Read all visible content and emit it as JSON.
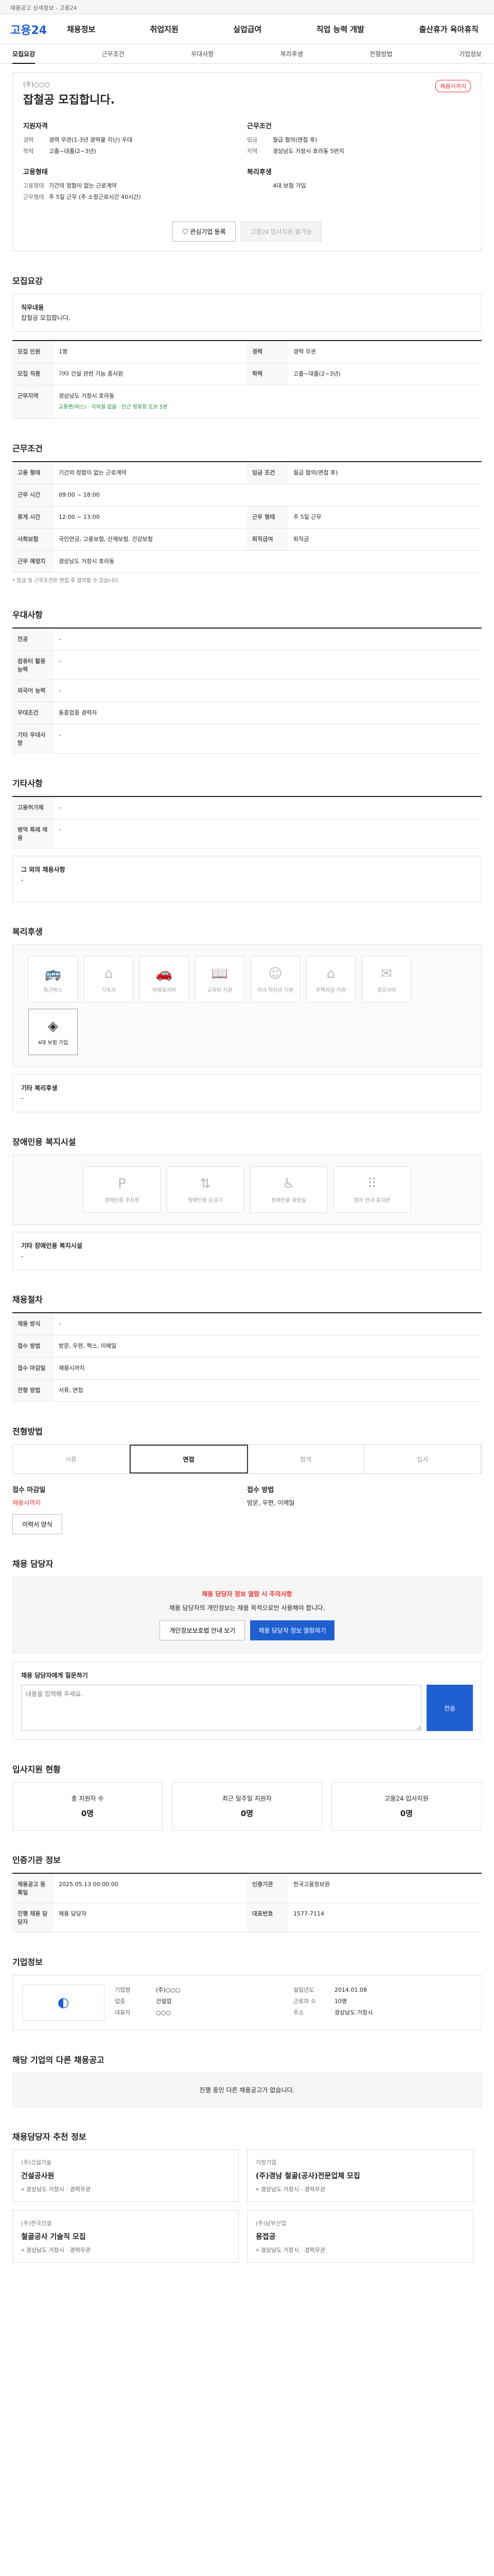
{
  "topbar": "채용공고 상세정보 - 고용24",
  "logo": "고용24",
  "gnb": [
    "채용정보",
    "취업지원",
    "실업급여",
    "직업 능력 개발",
    "출산휴가 육아휴직"
  ],
  "tabs": [
    "모집요강",
    "근무조건",
    "우대사항",
    "복리후생",
    "전형방법",
    "기업정보"
  ],
  "head": {
    "corp": "(주)○○○",
    "title": "잡철공 모집합니다.",
    "badge": "채용시까지"
  },
  "summary": {
    "left_title": "지원자격",
    "left": [
      [
        "경력",
        "경력 무관(1-3년 경력을 지닌) 우대"
      ],
      [
        "학력",
        "고졸~대졸(2~3년)"
      ]
    ],
    "right_title": "근무조건",
    "right": [
      [
        "임금",
        "월급 협의(면접 후)"
      ],
      [
        "지역",
        "경상남도 거창시 호라동 5번지"
      ]
    ],
    "left2_title": "고용형태",
    "left2": [
      [
        "고용형태",
        "기간의 정함이 없는 근로계약"
      ],
      [
        "근무형태",
        "주 5일 근무 (주 소정근로시간 40시간)"
      ]
    ],
    "right2_title": "복리후생",
    "right2": [
      [
        "",
        "4대 보험 가입"
      ]
    ]
  },
  "buttons": {
    "apply": "관심기업 등록",
    "online": "고용24 입사지원 불가능"
  },
  "s1": {
    "title": "모집요강",
    "job_label": "직무내용",
    "job": "잡철공 모집합니다.",
    "rows": [
      [
        "모집 인원",
        "1명"
      ],
      [
        "경력",
        "경력 무관"
      ],
      [
        "모집 직종",
        "기타 건설 관련 기능 종사원"
      ],
      [
        "학력",
        "고졸~대졸(2~3년)"
      ],
      [
        "근무지역",
        "경상남도 거창시 호라동"
      ]
    ],
    "badges": [
      "교통편(버스)",
      "지하철 없음",
      "인근 정류장 도보 5분"
    ]
  },
  "s2": {
    "title": "근무조건",
    "rows": [
      [
        "고용 형태",
        "기간의 정함이 없는 근로계약"
      ],
      [
        "임금 조건",
        "월급 협의(면접 후)"
      ],
      [
        "근무 시간",
        "09:00 ~ 18:00"
      ],
      [
        "휴게 시간",
        "12:00 ~ 13:00"
      ],
      [
        "근무 형태",
        "주 5일 근무"
      ],
      [
        "사회보험",
        "국민연금, 고용보험, 산재보험, 건강보험"
      ],
      [
        "근무 예정지",
        "경상남도 거창시 호라동"
      ],
      [
        "퇴직급여",
        "퇴직금"
      ]
    ],
    "note": "* 임금 및 근무조건은 면접 후 협의할 수 있습니다."
  },
  "s3": {
    "title": "우대사항",
    "rows": [
      [
        "전공",
        "-"
      ],
      [
        "컴퓨터 활용 능력",
        "-"
      ],
      [
        "외국어 능력",
        "-"
      ],
      [
        "우대조건",
        "동종업종 경력자"
      ],
      [
        "기타 우대사항",
        "-"
      ]
    ]
  },
  "s4": {
    "title": "기타사항",
    "rows": [
      [
        "고용허가제",
        "-"
      ],
      [
        "병역 특례 채용",
        "-"
      ]
    ],
    "extra_label": "그 외의 채용사항",
    "extra": "-"
  },
  "s5": {
    "title": "복리후생",
    "items": [
      "통근버스",
      "기숙사",
      "차량유지비",
      "교육비 지원",
      "자녀 학자금 지원",
      "주택자금 지원",
      "경조사비",
      "4대 보험 가입"
    ],
    "extra_label": "기타 복리후생",
    "extra": "-"
  },
  "s6": {
    "title": "장애인용 복지시설",
    "items": [
      "장애인용 주차장",
      "장애인용 승강기",
      "장애인용 화장실",
      "점자 안내 표지판"
    ],
    "extra_label": "기타 장애인용 복지시설",
    "extra": "-"
  },
  "s7": {
    "title": "채용절차",
    "rows": [
      [
        "채용 방식",
        "-"
      ],
      [
        "접수 방법",
        "방문, 우편, 팩스, 이메일"
      ],
      [
        "접수 마감일",
        "채용시까지"
      ],
      [
        "전형 방법",
        "서류, 면접"
      ]
    ]
  },
  "s8": {
    "title": "전형방법",
    "steps": [
      "서류",
      "면접",
      "합격",
      "입사"
    ],
    "apply_label": "접수 마감일",
    "apply": "채용시까지",
    "method_label": "접수 방법",
    "method": "방문, 우편, 이메일",
    "docs_btn": "이력서 양식"
  },
  "s9": {
    "title": "채용 담당자",
    "notice": "채용 담당자 정보 열람 시 주의사항",
    "desc": "채용 담당자의 개인정보는 채용 목적으로만 사용해야 합니다.",
    "btn1": "개인정보보호법 안내 보기",
    "btn2": "채용 담당자 정보 열람하기",
    "input_label": "채용 담당자에게 질문하기",
    "placeholder": "내용을 입력해 주세요.",
    "send": "전송"
  },
  "s10": {
    "title": "입사지원 현황",
    "stats": [
      [
        "총 지원자 수",
        "0명"
      ],
      [
        "최근 일주일 지원자",
        "0명"
      ],
      [
        "고용24 입사지원",
        "0명"
      ]
    ]
  },
  "s11": {
    "title": "인증기관 정보",
    "rows": [
      [
        "채용공고 등록일",
        "2025.05.13 00:00:00"
      ],
      [
        "인증기관",
        "한국고용정보원"
      ],
      [
        "진행 채용 담당자",
        "채용 담당자"
      ],
      [
        "대표번호",
        "1577-7114"
      ]
    ]
  },
  "s12": {
    "title": "기업정보",
    "rows": [
      [
        "기업명",
        "(주)○○○"
      ],
      [
        "업종",
        "건설업"
      ],
      [
        "대표자",
        "○○○"
      ],
      [
        "설립년도",
        "2014.01.08"
      ],
      [
        "근로자 수",
        "10명"
      ],
      [
        "주소",
        "경상남도 거창시"
      ]
    ]
  },
  "s13": {
    "title": "해당 기업의 다른 채용공고",
    "empty": "진행 중인 다른 채용공고가 없습니다."
  },
  "s14": {
    "title": "채용담당자 추천 정보",
    "cards": [
      [
        "(주)건설기술",
        "건설공사원",
        "경상남도 거창시",
        "경력무관"
      ],
      [
        "거창기업",
        "(주)경남 철골(공사)전문업체 모집",
        "경상남도 거창시",
        "경력무관"
      ],
      [
        "(주)한국건설",
        "철골공사 기술직 모집",
        "경상남도 거창시",
        "경력무관"
      ],
      [
        "(주)남부산업",
        "용접공",
        "경상남도 거창시",
        "경력무관"
      ]
    ]
  }
}
